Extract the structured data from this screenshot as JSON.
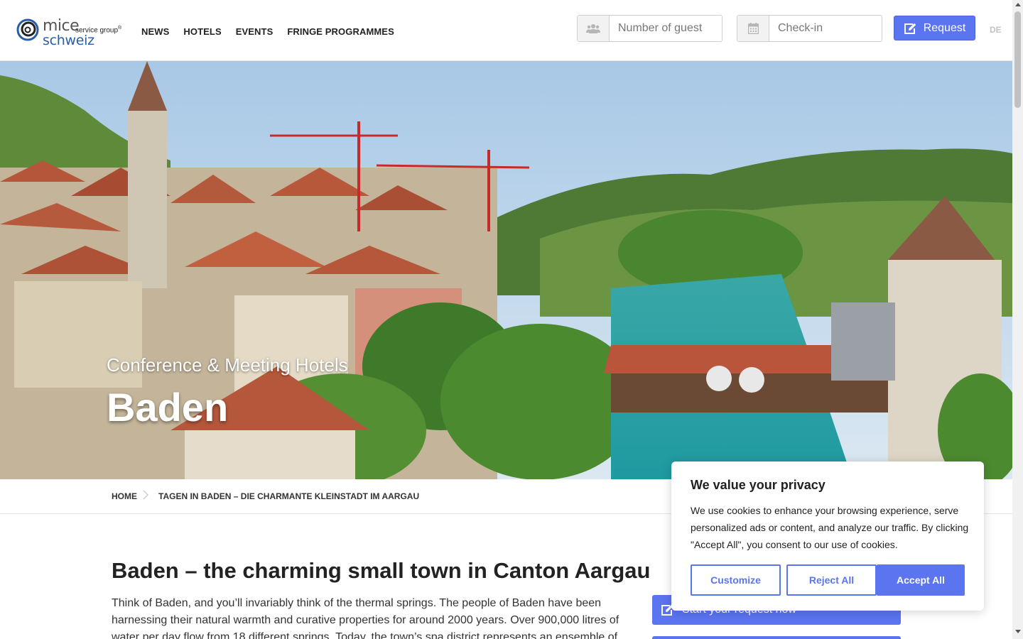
{
  "header": {
    "logo": {
      "line1": "mice",
      "line2": "service group",
      "line3": "schweiz",
      "trademark": "®"
    },
    "nav": [
      "NEWS",
      "HOTELS",
      "EVENTS",
      "FRINGE PROGRAMMES"
    ],
    "guest_field": {
      "placeholder": "Number of guest",
      "icon": "users-icon"
    },
    "checkin_field": {
      "placeholder": "Check-in",
      "icon": "calendar-icon"
    },
    "request_button": {
      "label": "Request",
      "icon": "edit-icon"
    },
    "language": "DE"
  },
  "hero": {
    "subtitle": "Conference & Meeting Hotels",
    "title": "Baden"
  },
  "breadcrumb": {
    "home": "HOME",
    "current": "TAGEN IN BADEN – DIE CHARMANTE KLEINSTADT IM AARGAU"
  },
  "article": {
    "title": "Baden – the charming small town in Canton Aargau",
    "body": "Think of Baden, and you’ll invariably think of the thermal springs. The people of Baden have been harnessing their natural warmth and curative properties for around 2000 years. Over 900,000 litres of water per day flow from 18 different springs. Today, the town’s spa district represents an ensemble of"
  },
  "sidebar": {
    "start_request_label": "Start your request now"
  },
  "cookie_banner": {
    "title": "We value your privacy",
    "text": "We use cookies to enhance your browsing experience, serve personalized ads or content, and analyze our traffic. By clicking \"Accept All\", you consent to our use of cookies.",
    "customize": "Customize",
    "reject_all": "Reject All",
    "accept_all": "Accept All"
  },
  "colors": {
    "accent": "#5b74f0",
    "logo_blue": "#2a5da8"
  }
}
